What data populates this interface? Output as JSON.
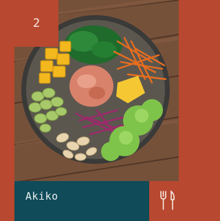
{
  "card": {
    "index": "2",
    "name": "Akiko",
    "icon": "fork-knife-icon"
  },
  "colors": {
    "background": "#b8482f",
    "name_bar": "#0f4b59",
    "text": "#f7ece4"
  }
}
